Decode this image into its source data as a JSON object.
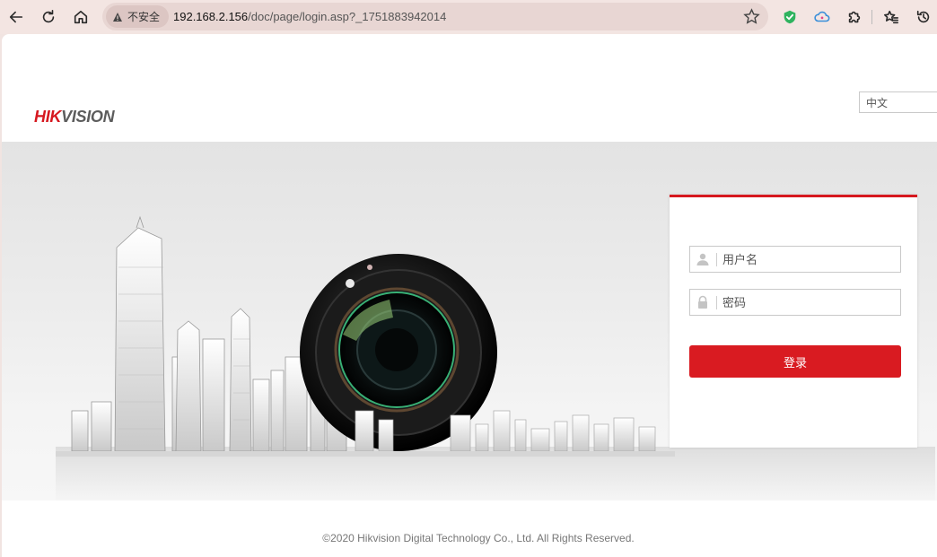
{
  "browser": {
    "security_label": "不安全",
    "url_host": "192.168.2.156",
    "url_path": "/doc/page/login.asp?_1751883942014"
  },
  "header": {
    "logo_hik": "HIK",
    "logo_vision": "VISION",
    "language": "中文"
  },
  "login": {
    "username_placeholder": "用户名",
    "password_placeholder": "密码",
    "submit_label": "登录"
  },
  "footer": {
    "copyright": "©2020 Hikvision Digital Technology Co., Ltd. All Rights Reserved."
  },
  "colors": {
    "brand_red": "#d6181f",
    "button_red": "#d91b21",
    "browser_chrome": "#f3e5e2"
  },
  "icons": [
    "back-arrow-icon",
    "reload-icon",
    "home-icon",
    "warning-icon",
    "star-icon",
    "shield-check-icon",
    "cloud-icon",
    "puzzle-icon",
    "favorites-icon",
    "history-icon",
    "user-icon",
    "lock-icon"
  ]
}
